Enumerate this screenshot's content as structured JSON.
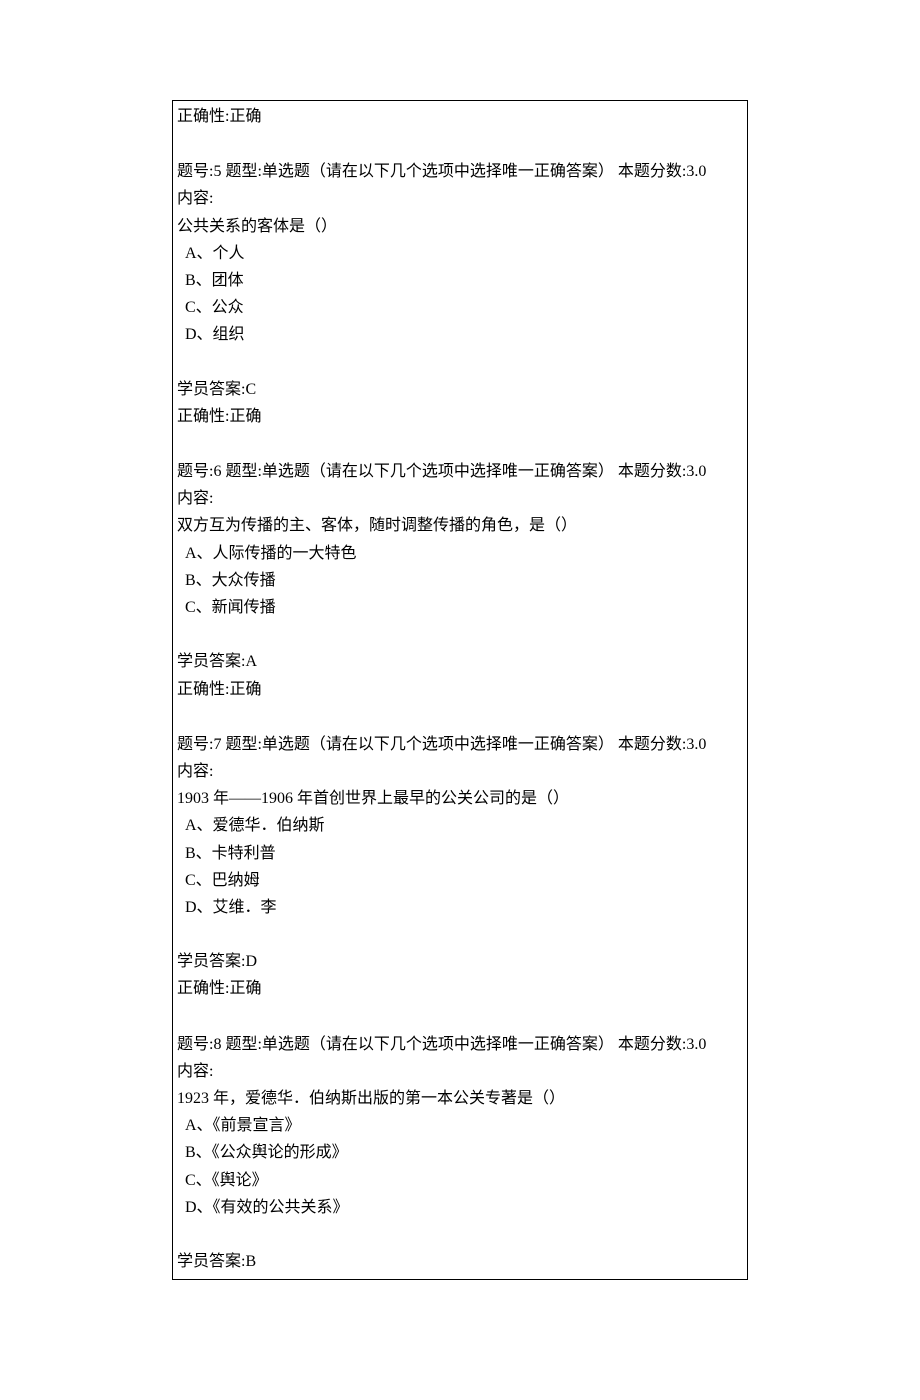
{
  "prev": {
    "correctness_label": "正确性:",
    "correctness_value": "正确"
  },
  "q5": {
    "header_prefix": "   题号:5   题型:单选题（请在以下几个选项中选择唯一正确答案）   本题分数:3.0",
    "content_label": "内容:",
    "stem": "公共关系的客体是（）",
    "optA": " A、个人",
    "optB": " B、团体",
    "optC": " C、公众",
    "optD": " D、组织",
    "answer_label": "学员答案:",
    "answer_value": "C",
    "correctness_label": "正确性:",
    "correctness_value": "正确"
  },
  "q6": {
    "header_prefix": "   题号:6   题型:单选题（请在以下几个选项中选择唯一正确答案）   本题分数:3.0",
    "content_label": "内容:",
    "stem": "双方互为传播的主、客体，随时调整传播的角色，是（）",
    "optA": " A、人际传播的一大特色",
    "optB": " B、大众传播",
    "optC": " C、新闻传播",
    "answer_label": "学员答案:",
    "answer_value": "A",
    "correctness_label": "正确性:",
    "correctness_value": "正确"
  },
  "q7": {
    "header_prefix": "   题号:7   题型:单选题（请在以下几个选项中选择唯一正确答案）   本题分数:3.0",
    "content_label": "内容:",
    "stem": "1903 年——1906 年首创世界上最早的公关公司的是（）",
    "optA": " A、爱德华．伯纳斯",
    "optB": " B、卡特利普",
    "optC": " C、巴纳姆",
    "optD": " D、艾维．李",
    "answer_label": "学员答案:",
    "answer_value": "D",
    "correctness_label": "正确性:",
    "correctness_value": "正确"
  },
  "q8": {
    "header_prefix": "   题号:8   题型:单选题（请在以下几个选项中选择唯一正确答案）   本题分数:3.0",
    "content_label": "内容:",
    "stem": "1923 年，爱德华．伯纳斯出版的第一本公关专著是（）",
    "optA": " A、《前景宣言》",
    "optB": " B、《公众舆论的形成》",
    "optC": " C、《舆论》",
    "optD": " D、《有效的公共关系》",
    "answer_label": "学员答案:",
    "answer_value": "B"
  }
}
